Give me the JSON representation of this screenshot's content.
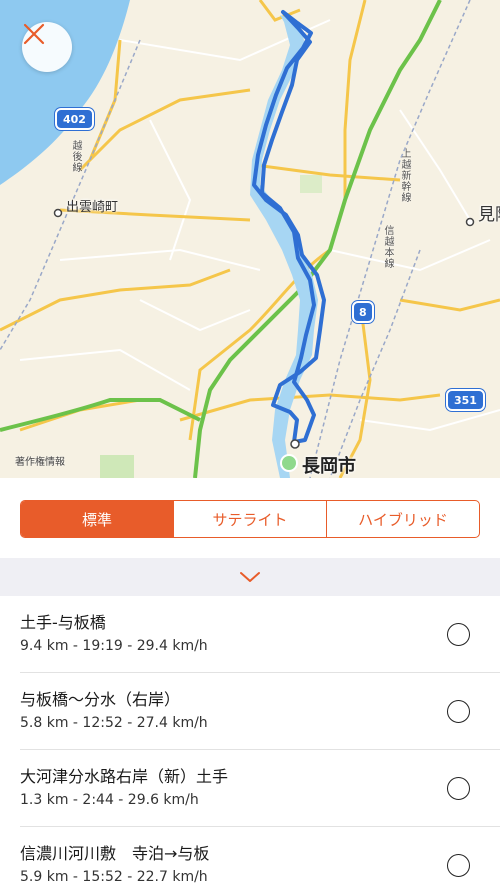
{
  "map": {
    "labels": {
      "izumozaki": "出雲崎町",
      "nagaoka": "長岡市",
      "mitsuke": "見附",
      "etsugo_line": "越後線",
      "joetsu_shinkansen": "上越新幹線",
      "shinetsu_line": "信越本線"
    },
    "route_shields": {
      "r402": "402",
      "r8": "8",
      "r351": "351"
    },
    "copyright": "著作権情報",
    "colors": {
      "sea": "#8ec9f0",
      "river": "#a7d6f3",
      "track": "#2f6fd3",
      "expressway": "#6cc24a",
      "major_road": "#f5c64a",
      "start_dot": "#8fd98c"
    }
  },
  "close_button": {
    "icon": "close-icon",
    "color": "#e85c2a"
  },
  "map_type_tabs": [
    {
      "label": "標準",
      "active": true
    },
    {
      "label": "サテライト",
      "active": false
    },
    {
      "label": "ハイブリッド",
      "active": false
    }
  ],
  "expand_icon": "chevron-down-icon",
  "segments": [
    {
      "title": "土手-与板橋",
      "stats": "9.4 km - 19:19 - 29.4 km/h"
    },
    {
      "title": "与板橋〜分水（右岸）",
      "stats": "5.8 km - 12:52 - 27.4 km/h"
    },
    {
      "title": "大河津分水路右岸（新）土手",
      "stats": "1.3 km - 2:44 - 29.6 km/h"
    },
    {
      "title": "信濃川河川敷　寺泊→与板",
      "stats": "5.9 km - 15:52 - 22.7 km/h"
    }
  ],
  "accent_color": "#e85c2a"
}
